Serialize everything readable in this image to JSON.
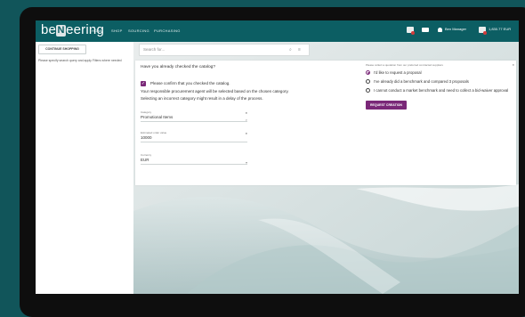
{
  "header": {
    "logo_prefix": "be",
    "logo_mark": "N",
    "logo_suffix": "eering",
    "nav": [
      "HOME",
      "SHOP",
      "SOURCING",
      "PURCHASING"
    ],
    "user": "Ben Manager",
    "cart_total": "1,830.77 EUR",
    "icons": [
      "cart-check-icon",
      "mail-icon",
      "user-icon",
      "cart-icon"
    ]
  },
  "sidebar": {
    "continue_label": "CONTINUE SHOPPING",
    "note": "Please specify search query and apply Filters where needed"
  },
  "search": {
    "placeholder": "Search for..."
  },
  "panel": {
    "question": "Have you already checked the catalog?",
    "confirm_label": "Please confirm that you checked the catalog.",
    "info_line1": "Your responsible procurement agent will be selected based on the chosen category.",
    "info_line2": "Selecting an incorrect category might result in a delay of the process.",
    "fields": [
      {
        "label": "Category",
        "value": "Promotional Items"
      },
      {
        "label": "Estimated order value",
        "value": "10000"
      },
      {
        "label": "Currency",
        "value": "EUR"
      }
    ],
    "right_title": "Please collect a quotation from our preferred contracted suppliers",
    "options": [
      {
        "label": "I'd like to request a proposal",
        "selected": true
      },
      {
        "label": "I've already did a benchmark and compared 3 proposals",
        "selected": false
      },
      {
        "label": "I cannot conduct a market benchmark and need to collect a bid-waiver approval",
        "selected": false
      }
    ],
    "request_button": "REQUEST CREATION"
  },
  "colors": {
    "brand": "#0c5e63",
    "accent": "#7a2878",
    "background": "#11555a"
  }
}
